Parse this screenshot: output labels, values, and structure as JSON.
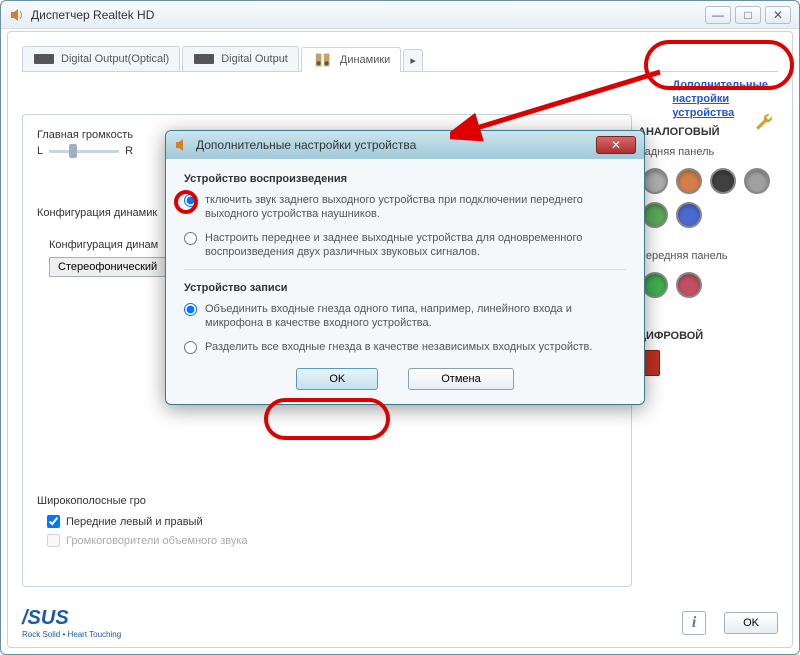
{
  "window": {
    "title": "Диспетчер Realtek HD"
  },
  "tabs": [
    {
      "label": "Digital Output(Optical)"
    },
    {
      "label": "Digital Output"
    },
    {
      "label": "Динамики"
    }
  ],
  "right_link": {
    "line1": "Дополнительные",
    "line2": "настройки",
    "line3": "устройства"
  },
  "volume": {
    "title": "Главная громкость",
    "left": "L",
    "right": "R"
  },
  "config": {
    "title": "Конфигурация динамик",
    "sub_title": "Конфигурация динам",
    "option": "Стереофонический"
  },
  "wideband": {
    "title": "Широкополосные гро",
    "opt1": "Передние левый и правый",
    "opt2": "Громкоговорители объемного звука"
  },
  "analog": {
    "title": "АНАЛОГОВЫЙ",
    "back": "Задняя панель",
    "front": "Передняя панель",
    "sockets_back": [
      "#b0b0b0",
      "#d47f4a",
      "#404040",
      "#a0a0a0",
      "#5aaa5a",
      "#4a6ad0"
    ],
    "sockets_front": [
      "#40b050",
      "#c05060"
    ]
  },
  "digital": {
    "title": "ЦИФРОВОЙ"
  },
  "footer": {
    "logo": "/SUS",
    "tagline": "Rock Solid • Heart Touching",
    "ok": "OK",
    "info": "i"
  },
  "dialog": {
    "title": "Дополнительные настройки устройства",
    "playback_title": "Устройство воспроизведения",
    "playback_opt1": "тключить звук заднего выходного устройства при подключении переднего выходного устройства наушников.",
    "playback_opt2": "Настроить переднее и заднее выходные устройства для одновременного воспроизведения двух различных звуковых сигналов.",
    "record_title": "Устройство записи",
    "record_opt1": "Объединить входные гнезда одного типа, например, линейного входа и микрофона в качестве входного устройства.",
    "record_opt2": "Разделить все входные гнезда в качестве независимых входных устройств.",
    "ok": "OK",
    "cancel": "Отмена"
  }
}
